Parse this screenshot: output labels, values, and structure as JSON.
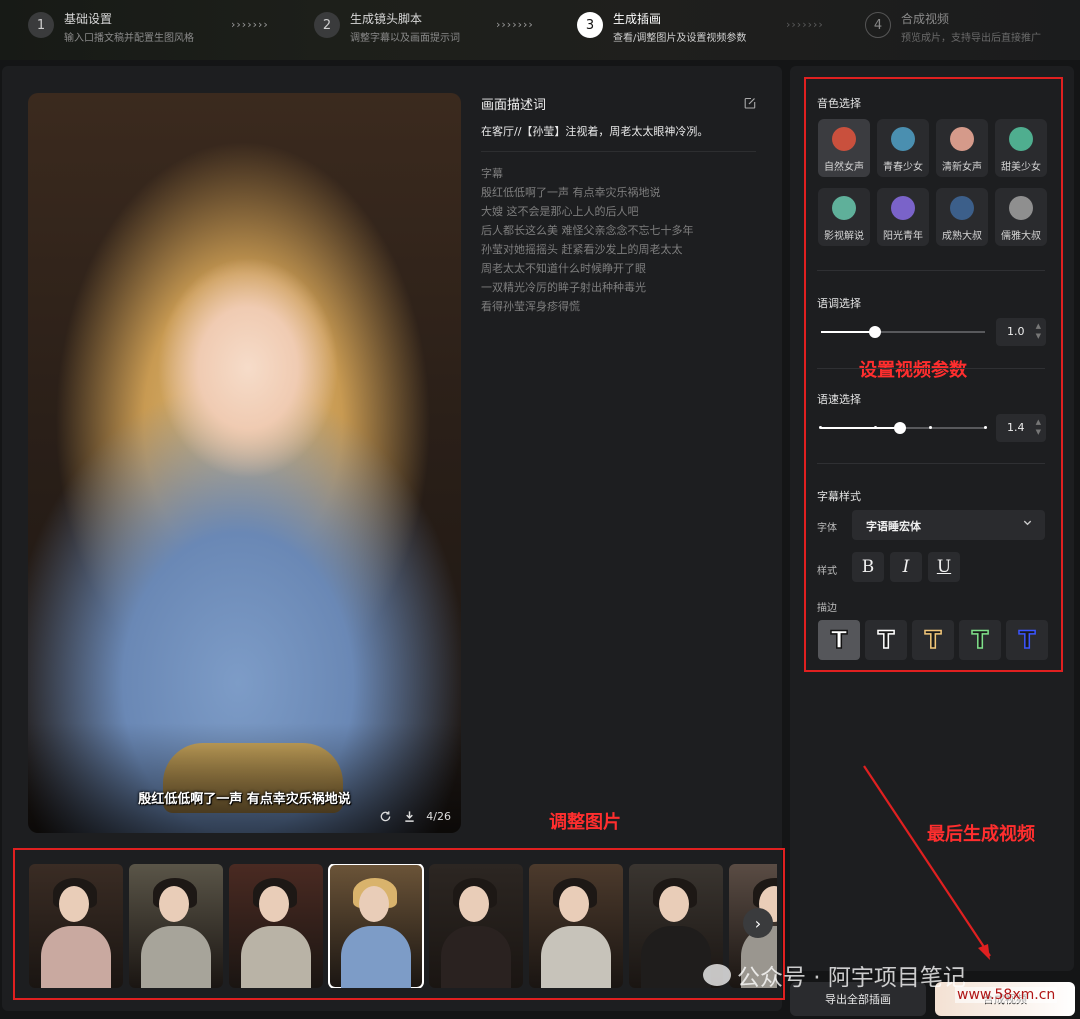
{
  "steps": [
    {
      "num": "1",
      "title": "基础设置",
      "desc": "输入口播文稿并配置生图风格"
    },
    {
      "num": "2",
      "title": "生成镜头脚本",
      "desc": "调整字幕以及画面提示词"
    },
    {
      "num": "3",
      "title": "生成插画",
      "desc": "查看/调整图片及设置视频参数"
    },
    {
      "num": "4",
      "title": "合成视频",
      "desc": "预览成片，支持导出后直接推广"
    }
  ],
  "step_arrows": "›››››››",
  "preview": {
    "subtitle": "殷红低低啊了一声  有点幸灾乐祸地说",
    "counter": "4/26"
  },
  "description": {
    "label": "画面描述词",
    "text": "在客厅//【孙莹】注视着，周老太太眼神冷冽。",
    "subtitle_head": "字幕",
    "subtitle_lines": [
      "殷红低低啊了一声 有点幸灾乐祸地说",
      "大嫂 这不会是那心上人的后人吧",
      "后人都长这么美 难怪父亲念念不忘七十多年",
      "孙莹对她摇摇头 赶紧看沙发上的周老太太",
      "周老太太不知道什么时候睁开了眼",
      "一双精光冷厉的眸子射出种种毒光",
      "看得孙莹浑身疹得慌"
    ]
  },
  "annotations": {
    "adjust_images": "调整图片",
    "set_params": "设置视频参数",
    "final_generate": "最后生成视频"
  },
  "settings": {
    "voice_title": "音色选择",
    "voices": [
      {
        "label": "自然女声",
        "color": "#c9503d"
      },
      {
        "label": "青春少女",
        "color": "#4a8fb0"
      },
      {
        "label": "清新女声",
        "color": "#d59a8a"
      },
      {
        "label": "甜美少女",
        "color": "#4fae8f"
      },
      {
        "label": "影视解说",
        "color": "#5fb09a"
      },
      {
        "label": "阳光青年",
        "color": "#7a63c9"
      },
      {
        "label": "成熟大叔",
        "color": "#3c5f8a"
      },
      {
        "label": "儒雅大叔",
        "color": "#8f8f8f"
      }
    ],
    "pitch_title": "语调选择",
    "pitch_value": "1.0",
    "pitch_fraction": 0.33,
    "speed_title": "语速选择",
    "speed_value": "1.4",
    "speed_fraction": 0.48,
    "subtitle_style_title": "字幕样式",
    "font_label": "字体",
    "font_value": "字语睡宏体",
    "style_label": "样式",
    "style_buttons": [
      "B",
      "I",
      "U"
    ],
    "stroke_label": "描边",
    "stroke_glyph": "T",
    "stroke_colors": [
      "#ffffff",
      "#ffffff",
      "#f2c77a",
      "#7fe08a",
      "#3b55ff"
    ]
  },
  "thumbnails": [
    {
      "bg": "#3a2c24",
      "body": "#c9a9a0"
    },
    {
      "bg": "#5a5548",
      "body": "#a7a49a"
    },
    {
      "bg": "#4a2a22",
      "body": "#b9b3a6"
    },
    {
      "bg": "#6b5438",
      "body": "#7d9cc7"
    },
    {
      "bg": "#2c2622",
      "body": "#2a2220"
    },
    {
      "bg": "#4c3a2c",
      "body": "#c7c3ba"
    },
    {
      "bg": "#3a3530",
      "body": "#1f1d1c"
    },
    {
      "bg": "#5a4c44",
      "body": "#9a968f"
    }
  ],
  "watermark": "公众号 · 阿宇项目笔记",
  "site_mark": "www.58xm.cn",
  "buttons": {
    "export_all": "导出全部插画",
    "compose_video": "合成视频"
  }
}
